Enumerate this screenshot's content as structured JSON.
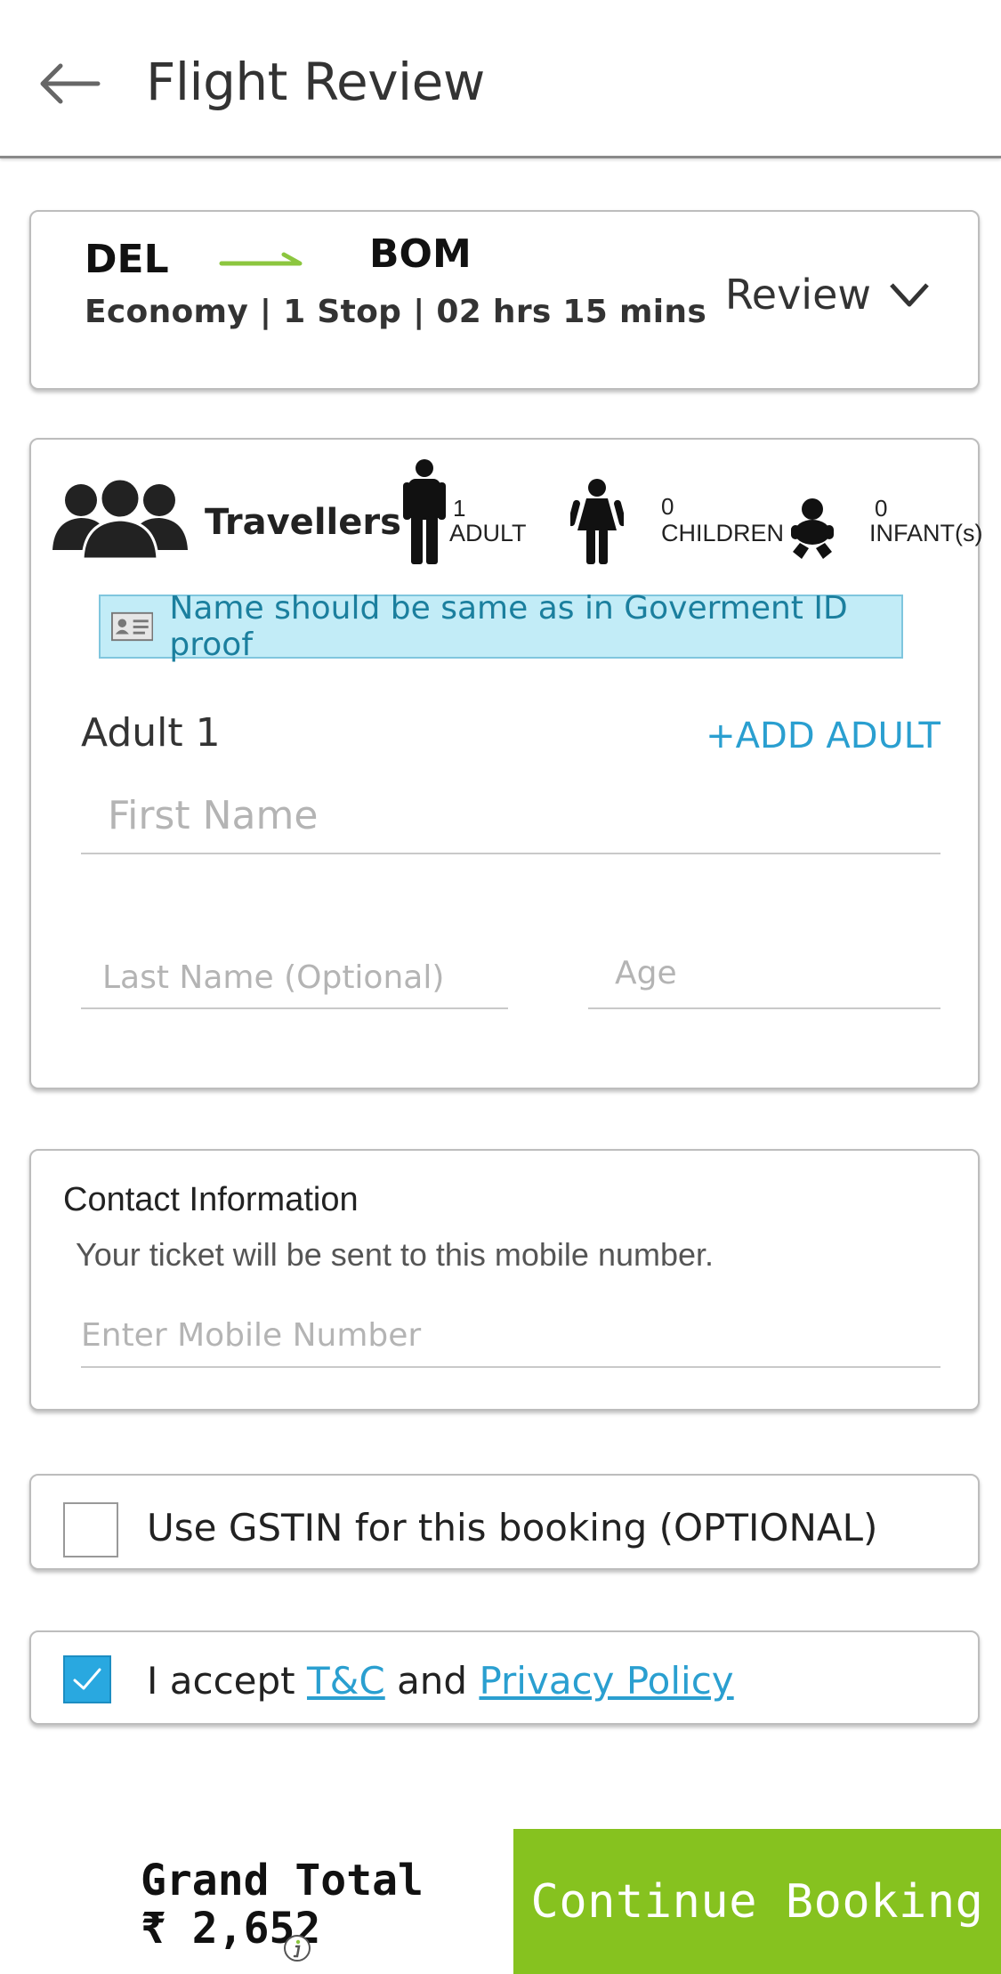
{
  "header": {
    "title": "Flight Review"
  },
  "flight": {
    "from": "DEL",
    "to": "BOM",
    "details": "Economy | 1 Stop | 02 hrs 15 mins",
    "review_label": "Review",
    "arrow_color": "#8cc63f"
  },
  "travellers": {
    "title": "Travellers",
    "adult_count": "1",
    "adult_label": "ADULT",
    "children_count": "0",
    "children_label": "CHILDREN",
    "infant_count": "0",
    "infant_label": "INFANT(s)",
    "note": "Name should be same as in Goverment ID proof",
    "adult_section_title": "Adult 1",
    "add_adult_label": "+ADD ADULT",
    "first_name_placeholder": "First Name",
    "last_name_placeholder": "Last Name (Optional)",
    "age_placeholder": "Age"
  },
  "contact": {
    "title": "Contact Information",
    "subtitle": "Your ticket will be sent to this mobile number.",
    "mobile_placeholder": "Enter Mobile Number"
  },
  "gstin": {
    "label": "Use GSTIN for this booking  (OPTIONAL)",
    "checked": false
  },
  "terms": {
    "prefix": "I accept ",
    "tc_link": "T&C",
    "middle": " and ",
    "privacy_link": "Privacy Policy",
    "checked": true
  },
  "footer": {
    "total_label": "Grand Total",
    "total_amount": "₹ 2,652",
    "continue_label": "Continue Booking",
    "button_color": "#86c21f"
  }
}
